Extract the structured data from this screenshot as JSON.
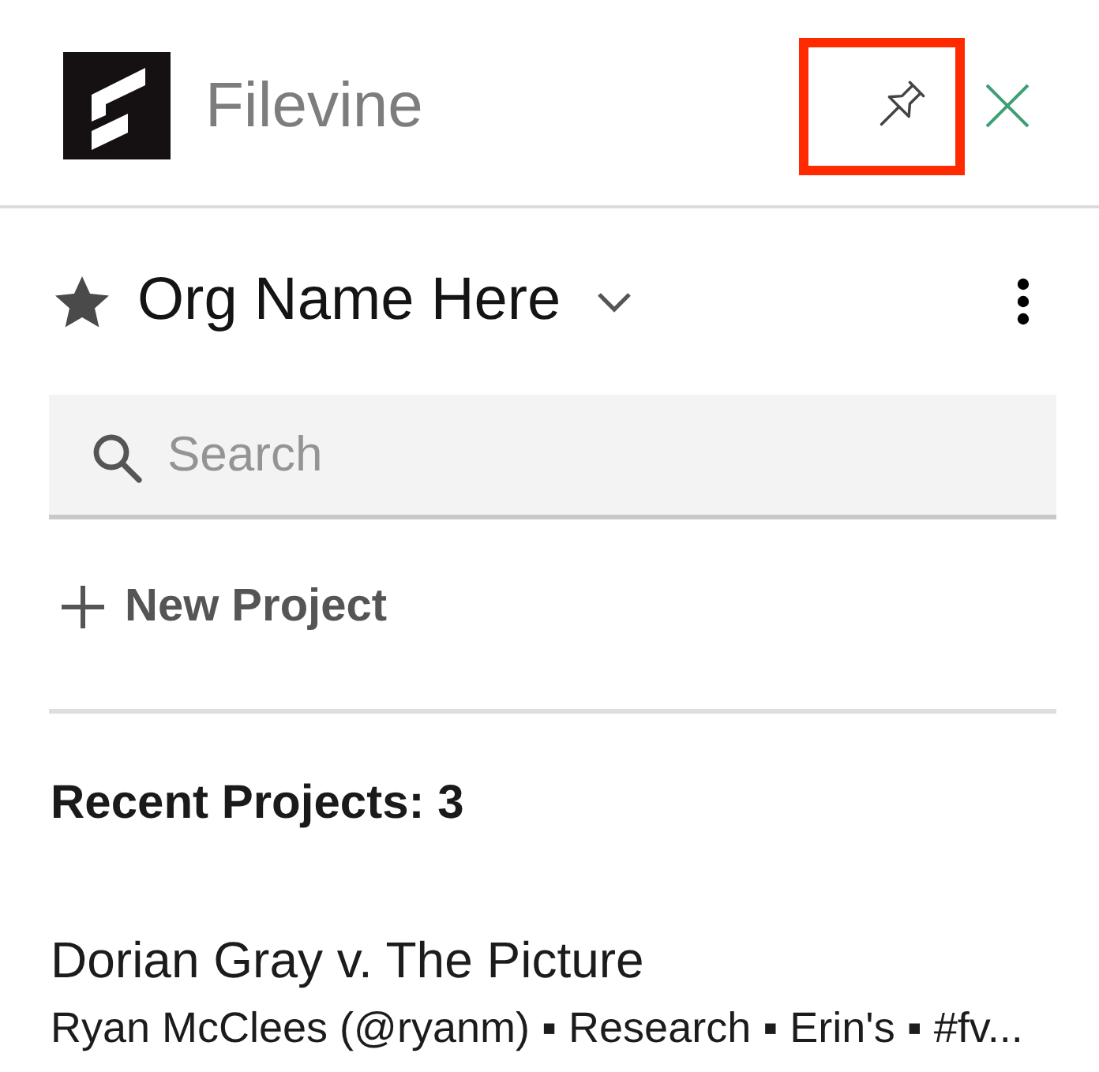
{
  "header": {
    "brand": "Filevine",
    "pin": {
      "highlighted": true
    }
  },
  "org": {
    "name": "Org Name Here",
    "favorite": true
  },
  "search": {
    "placeholder": "Search"
  },
  "new_project": {
    "label": "New Project"
  },
  "recent": {
    "heading": "Recent Projects: 3",
    "projects": [
      {
        "title": "Dorian Gray v. The Picture",
        "details": "Ryan McClees (@ryanm) ▪ Research ▪ Erin's ▪ #fv..."
      }
    ]
  }
}
